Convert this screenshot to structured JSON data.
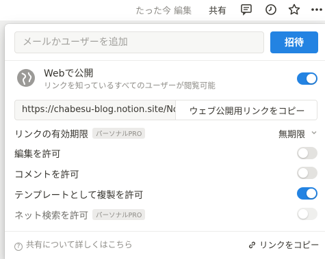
{
  "topbar": {
    "edited": "たった今 編集",
    "share": "共有",
    "icons": [
      "comment-icon",
      "clock-icon",
      "star-icon",
      "more-icon"
    ]
  },
  "invite": {
    "placeholder": "メールかユーザーを追加",
    "button": "招待"
  },
  "publish": {
    "title": "Webで公開",
    "subtitle": "リンクを知っているすべてのユーザーが閲覧可能",
    "enabled": true
  },
  "link": {
    "url": "https://chabesu-blog.notion.site/Notion-Blog",
    "copy_button": "ウェブ公開用リンクをコピー"
  },
  "settings": {
    "expiry_label": "リンクの有効期限",
    "expiry_badge": "パーソナルPRO",
    "expiry_value": "無期限",
    "allow_edit": {
      "label": "編集を許可",
      "on": false
    },
    "allow_comment": {
      "label": "コメントを許可",
      "on": false
    },
    "allow_duplicate": {
      "label": "テンプレートとして複製を許可",
      "on": true
    },
    "allow_search": {
      "label": "ネット検索を許可",
      "badge": "パーソナルPRO",
      "on": false,
      "disabled": true
    }
  },
  "footer": {
    "help": "共有について詳しくはこちら",
    "copy_link": "リンクをコピー"
  },
  "colors": {
    "accent": "#2383e2",
    "text": "#37352f",
    "muted": "#8e8c87"
  }
}
